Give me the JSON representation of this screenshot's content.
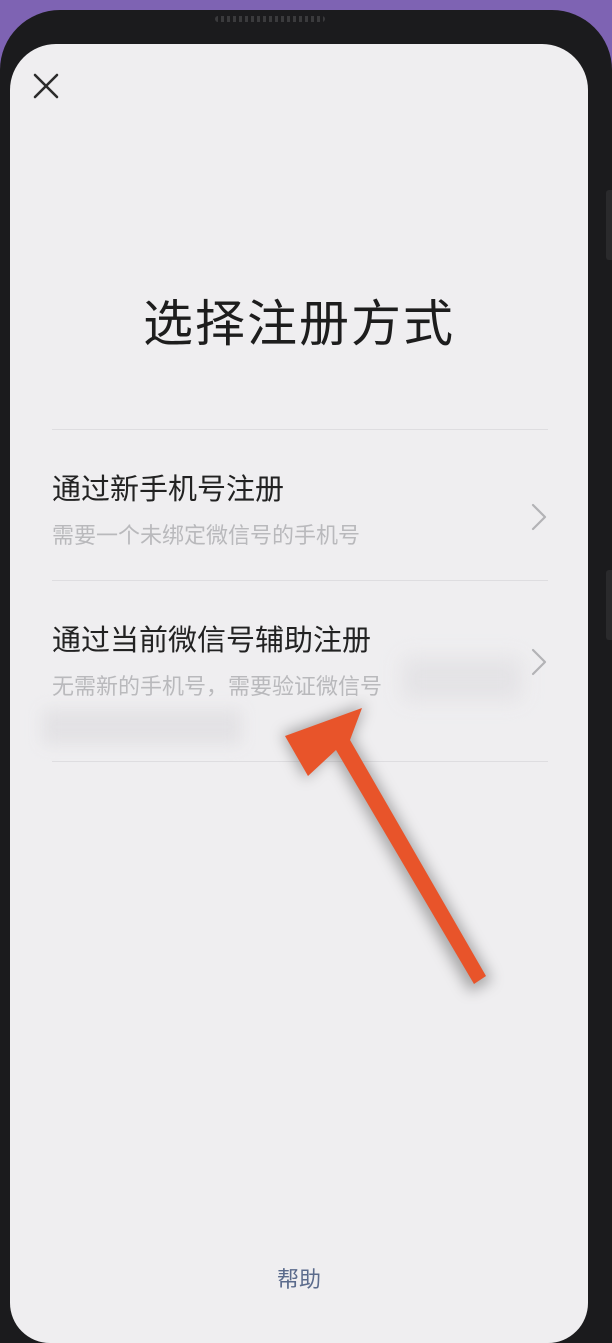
{
  "page": {
    "title": "选择注册方式",
    "help_label": "帮助"
  },
  "options": [
    {
      "title": "通过新手机号注册",
      "description": "需要一个未绑定微信号的手机号"
    },
    {
      "title": "通过当前微信号辅助注册",
      "description": "无需新的手机号，需要验证微信号"
    }
  ],
  "icons": {
    "close": "close-icon",
    "chevron": "chevron-right-icon",
    "annotation": "arrow-annotation"
  },
  "colors": {
    "frame_background": "#7e63b3",
    "screen_background": "#efeef0",
    "annotation_arrow": "#e8542a",
    "help_link": "#5b6b8c"
  }
}
